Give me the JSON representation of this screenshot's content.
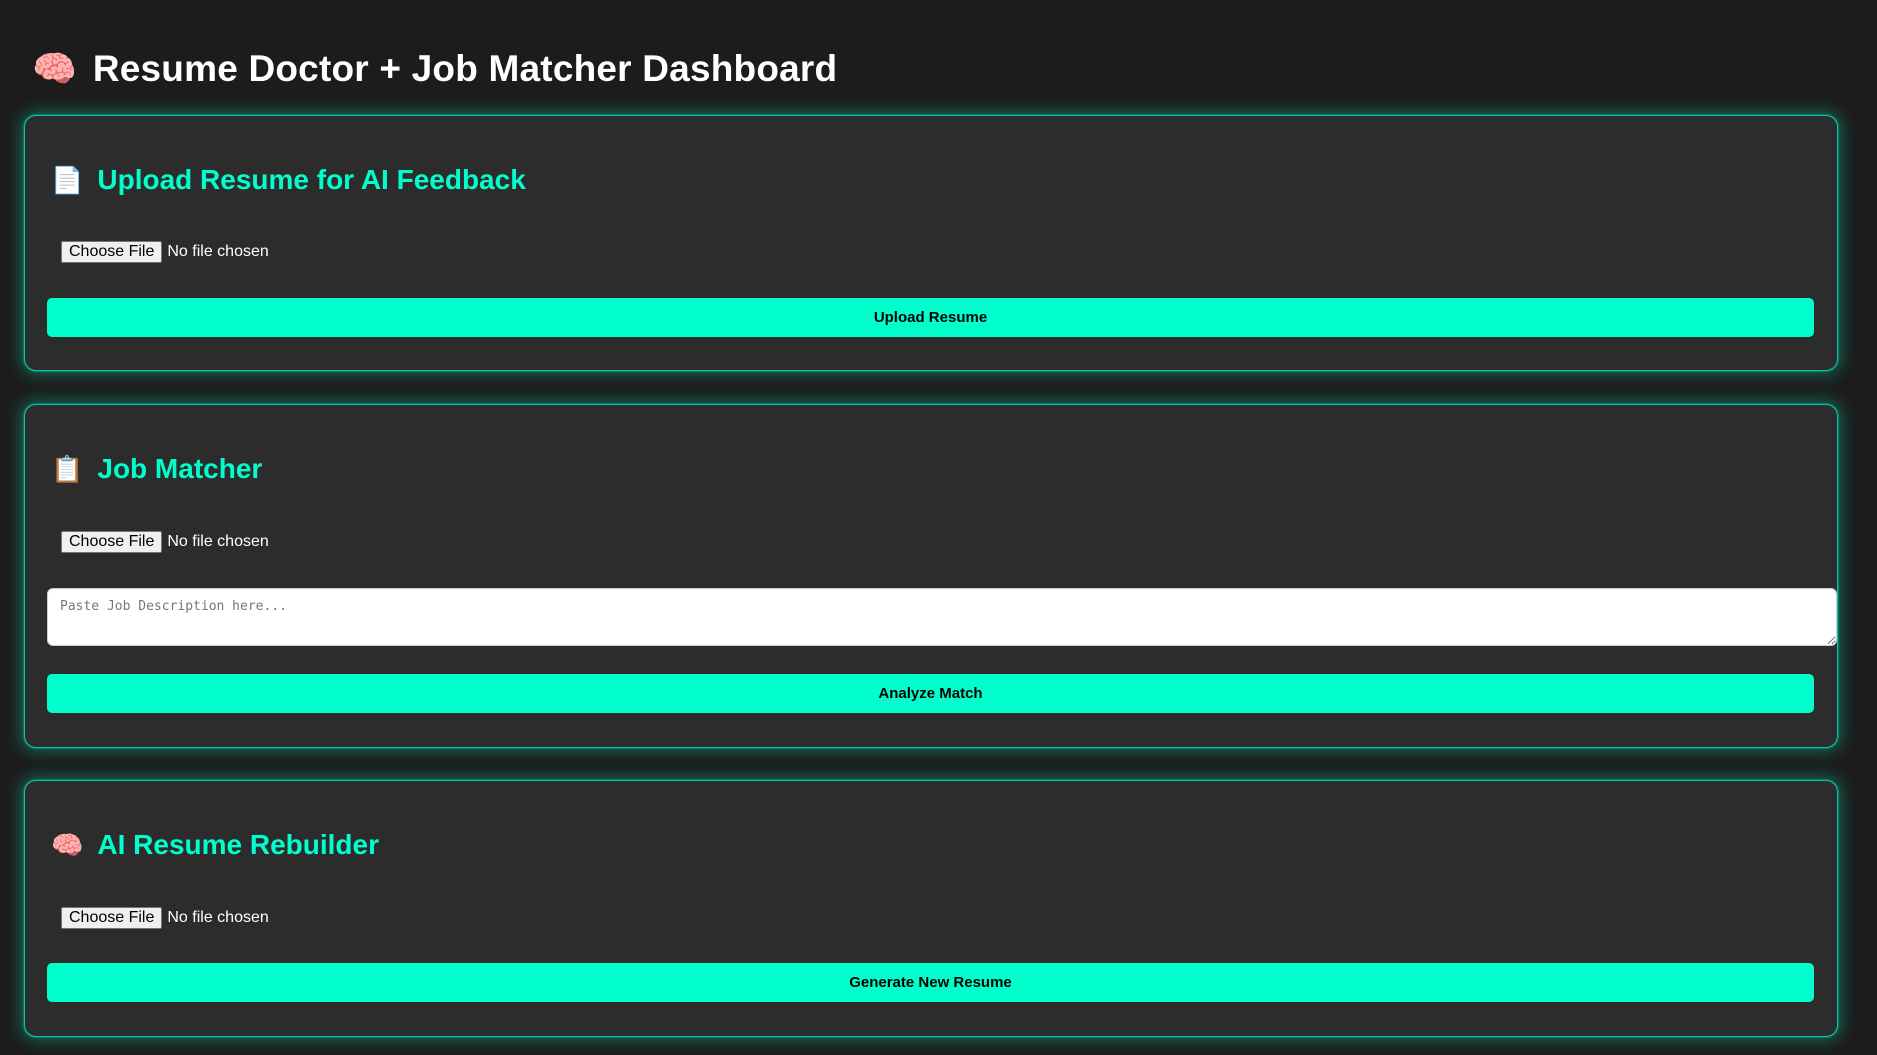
{
  "header": {
    "emoji": "🧠",
    "title": "Resume Doctor + Job Matcher Dashboard"
  },
  "cards": {
    "upload": {
      "emoji": "📄",
      "title": "Upload Resume for AI Feedback",
      "file_button": "Choose File",
      "file_status": "No file chosen",
      "action_label": "Upload Resume"
    },
    "matcher": {
      "emoji": "📋",
      "title": "Job Matcher",
      "file_button": "Choose File",
      "file_status": "No file chosen",
      "jd_placeholder": "Paste Job Description here...",
      "action_label": "Analyze Match"
    },
    "rebuilder": {
      "emoji": "🧠",
      "title": "AI Resume Rebuilder",
      "file_button": "Choose File",
      "file_status": "No file chosen",
      "action_label": "Generate New Resume"
    }
  },
  "colors": {
    "background": "#1c1c1c",
    "card": "#2c2c2c",
    "accent": "#00ffcc"
  }
}
